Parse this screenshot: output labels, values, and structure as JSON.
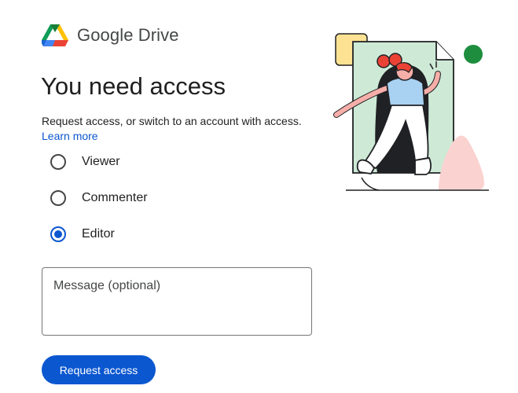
{
  "brand": {
    "name": "Google Drive",
    "logo_icon": "google-drive-logo",
    "logo_colors": [
      "#0f9d58",
      "#ffc107",
      "#4285f4",
      "#ea4335",
      "#188038",
      "#1967d2"
    ]
  },
  "access": {
    "title": "You need access",
    "subtitle": "Request access, or switch to an account with access.",
    "learn_more": "Learn more"
  },
  "roles": {
    "options": [
      {
        "label": "Viewer",
        "selected": false
      },
      {
        "label": "Commenter",
        "selected": false
      },
      {
        "label": "Editor",
        "selected": true
      }
    ]
  },
  "message": {
    "placeholder": "Message (optional)",
    "value": ""
  },
  "actions": {
    "request_label": "Request access"
  },
  "colors": {
    "accent": "#0b57d0",
    "text": "#1f1f1f",
    "secondary_text": "#444746"
  },
  "illustration": {
    "icon": "person-walking-through-document-illustration"
  }
}
